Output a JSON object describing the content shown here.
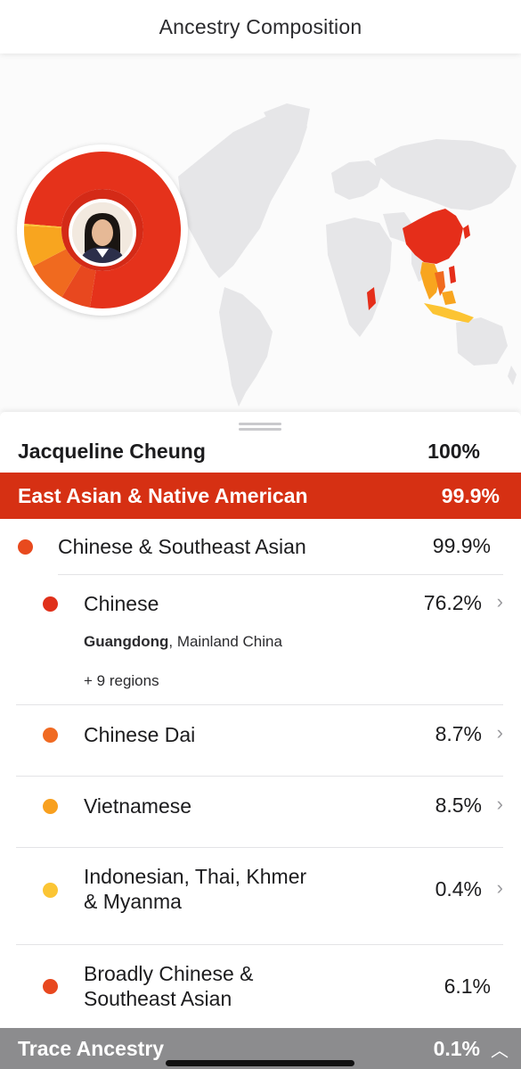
{
  "header": {
    "title": "Ancestry Composition"
  },
  "donut": {
    "segments": [
      {
        "name": "Chinese",
        "percent": 76.2,
        "color": "#e5321b"
      },
      {
        "name": "Chinese Dai",
        "percent": 8.7,
        "color": "#f06a1f"
      },
      {
        "name": "Vietnamese",
        "percent": 8.5,
        "color": "#f8a51f"
      },
      {
        "name": "Indonesian, Thai, Khmer & Myanma",
        "percent": 0.4,
        "color": "#fcc433"
      },
      {
        "name": "Broadly Chinese & Southeast Asian",
        "percent": 6.1,
        "color": "#e8481f"
      }
    ]
  },
  "person": {
    "name": "Jacqueline Cheung",
    "percent": "100%"
  },
  "group": {
    "label": "East Asian & Native American",
    "percent": "99.9%",
    "color": "#d63013"
  },
  "subgroup": {
    "label": "Chinese & Southeast Asian",
    "percent": "99.9%",
    "dot_color": "#e84a1e"
  },
  "items": [
    {
      "label": "Chinese",
      "percent": "76.2%",
      "dot_color": "#e0301a",
      "detail_bold": "Guangdong",
      "detail_rest": ", Mainland China",
      "more": "+ 9 regions"
    },
    {
      "label": "Chinese Dai",
      "percent": "8.7%",
      "dot_color": "#f06a22"
    },
    {
      "label": "Vietnamese",
      "percent": "8.5%",
      "dot_color": "#f8a01f"
    },
    {
      "label_line1": "Indonesian, Thai, Khmer",
      "label_line2": "& Myanma",
      "percent": "0.4%",
      "dot_color": "#fbc534"
    },
    {
      "label_line1": "Broadly Chinese &",
      "label_line2": "Southeast Asian",
      "percent": "6.1%",
      "dot_color": "#e8481f"
    }
  ],
  "bottom": {
    "label": "Trace Ancestry",
    "percent": "0.1%"
  }
}
